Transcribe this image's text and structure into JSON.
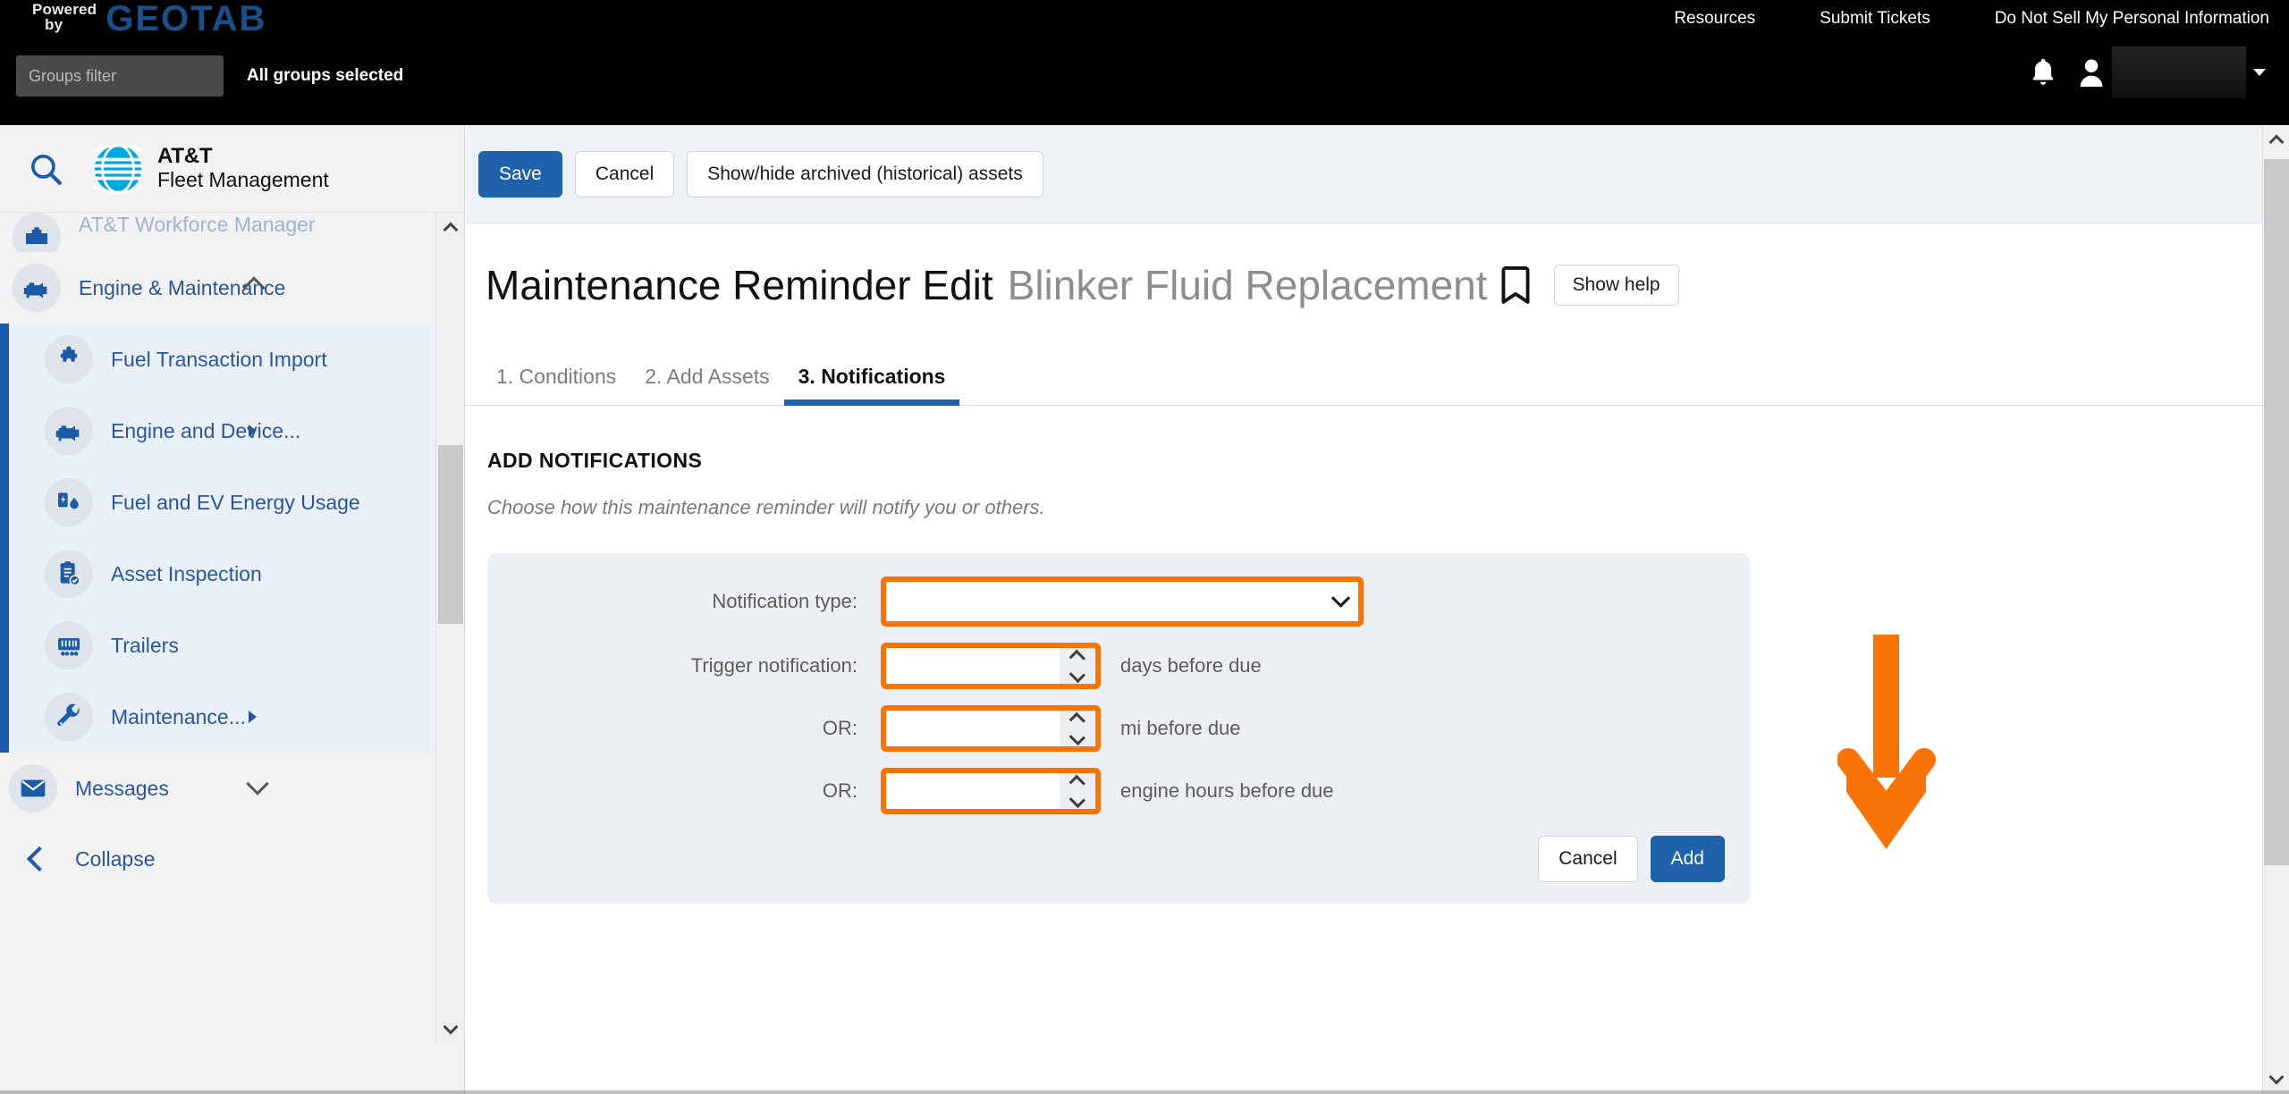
{
  "topbar": {
    "powered_line1": "Powered",
    "powered_line2": "by",
    "brand": "GEOTAB",
    "groups_filter_placeholder": "Groups filter",
    "groups_filter_value": "",
    "all_groups_label": "All groups selected",
    "links": [
      {
        "label": "Resources",
        "name": "resources"
      },
      {
        "label": "Submit Tickets",
        "name": "submit-tickets"
      },
      {
        "label": "Do Not Sell My Personal Information",
        "name": "do-not-sell"
      }
    ],
    "bell_icon": "notification-bell-icon",
    "user_icon": "user-avatar-icon",
    "user_name": "",
    "user_caret_icon": "chevron-down-icon"
  },
  "sidebar": {
    "search_icon": "search-icon",
    "logo_line1": "AT&T",
    "logo_line2": "Fleet Management",
    "partial_item": {
      "label": "AT&T Workforce Manager",
      "icon": "workforce-icon"
    },
    "group": {
      "label": "Engine & Maintenance",
      "icon": "engine-icon",
      "expanded": true,
      "chevron": "chevron-up-icon"
    },
    "children": [
      {
        "label": "Fuel Transaction Import",
        "icon": "puzzle-piece-icon",
        "has_submenu": false
      },
      {
        "label": "Engine and Device...",
        "icon": "engine-icon",
        "has_submenu": true
      },
      {
        "label": "Fuel and EV Energy Usage",
        "icon": "fuel-ev-icon",
        "has_submenu": false
      },
      {
        "label": "Asset Inspection",
        "icon": "clipboard-check-icon",
        "has_submenu": false
      },
      {
        "label": "Trailers",
        "icon": "trailer-icon",
        "has_submenu": false
      },
      {
        "label": "Maintenance...",
        "icon": "wrench-icon",
        "has_submenu": true
      }
    ],
    "messages": {
      "label": "Messages",
      "icon": "envelope-icon",
      "chevron": "chevron-down-icon"
    },
    "collapse": {
      "label": "Collapse",
      "icon": "chevron-left-icon"
    }
  },
  "toolbar": {
    "save_label": "Save",
    "cancel_label": "Cancel",
    "archived_label": "Show/hide archived (historical) assets"
  },
  "page": {
    "title": "Maintenance Reminder Edit",
    "subtitle": "Blinker Fluid Replacement",
    "bookmark_icon": "bookmark-icon",
    "show_help_label": "Show help"
  },
  "tabs": [
    {
      "label": "1. Conditions",
      "name": "tab-conditions",
      "active": false
    },
    {
      "label": "2. Add Assets",
      "name": "tab-add-assets",
      "active": false
    },
    {
      "label": "3. Notifications",
      "name": "tab-notifications",
      "active": true
    }
  ],
  "main": {
    "section_title": "ADD NOTIFICATIONS",
    "section_desc": "Choose how this maintenance reminder will notify you or others.",
    "form": {
      "notification_type": {
        "label": "Notification type:",
        "value": "",
        "options": [
          ""
        ],
        "chevron_icon": "chevron-down-icon"
      },
      "trigger_notification": {
        "label": "Trigger notification:",
        "value": "",
        "unit": "days before due",
        "spinner_icon": "spinner-updown-icon"
      },
      "or_distance": {
        "label": "OR:",
        "value": "",
        "unit": "mi before due",
        "spinner_icon": "spinner-updown-icon"
      },
      "or_engine_hours": {
        "label": "OR:",
        "value": "",
        "unit": "engine hours before due",
        "spinner_icon": "spinner-updown-icon"
      }
    },
    "actions": {
      "cancel_label": "Cancel",
      "add_label": "Add"
    }
  },
  "annotation": {
    "arrow_icon": "down-arrow-annotation-icon",
    "color": "#f97306"
  },
  "scrollbars": {
    "up_icon": "chevron-up-icon",
    "down_icon": "chevron-down-icon"
  },
  "colors": {
    "accent_blue": "#1e62ab",
    "brand_blue": "#2b5797",
    "highlight_orange": "#f97306",
    "topbar_black": "#000000"
  }
}
